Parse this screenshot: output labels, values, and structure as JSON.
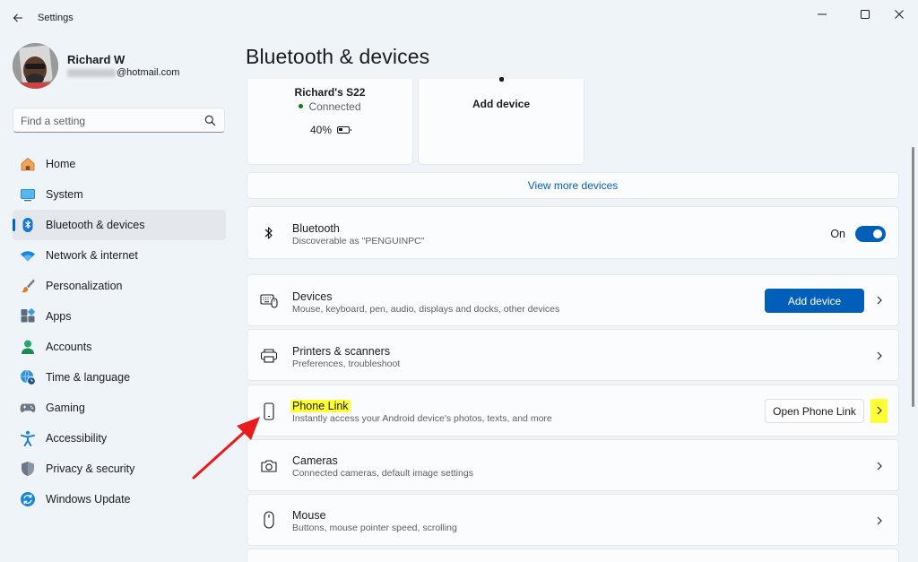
{
  "window": {
    "app_title": "Settings"
  },
  "profile": {
    "name": "Richard W",
    "email_visible": "@hotmail.com"
  },
  "search": {
    "placeholder": "Find a setting"
  },
  "nav": {
    "items": [
      {
        "label": "Home",
        "icon": "home-icon",
        "active": false
      },
      {
        "label": "System",
        "icon": "system-icon",
        "active": false
      },
      {
        "label": "Bluetooth & devices",
        "icon": "bluetooth-icon",
        "active": true
      },
      {
        "label": "Network & internet",
        "icon": "wifi-icon",
        "active": false
      },
      {
        "label": "Personalization",
        "icon": "brush-icon",
        "active": false
      },
      {
        "label": "Apps",
        "icon": "apps-icon",
        "active": false
      },
      {
        "label": "Accounts",
        "icon": "person-icon",
        "active": false
      },
      {
        "label": "Time & language",
        "icon": "globe-clock-icon",
        "active": false
      },
      {
        "label": "Gaming",
        "icon": "gamepad-icon",
        "active": false
      },
      {
        "label": "Accessibility",
        "icon": "accessibility-icon",
        "active": false
      },
      {
        "label": "Privacy & security",
        "icon": "shield-icon",
        "active": false
      },
      {
        "label": "Windows Update",
        "icon": "update-icon",
        "active": false
      }
    ]
  },
  "main": {
    "title": "Bluetooth & devices",
    "device_tiles": [
      {
        "name": "Richard's S22",
        "status": "Connected",
        "battery": "40%"
      },
      {
        "name": "Add device"
      }
    ],
    "view_more": "View more devices",
    "bluetooth": {
      "title": "Bluetooth",
      "subtitle": "Discoverable as \"PENGUINPC\"",
      "state_label": "On"
    },
    "devices": {
      "title": "Devices",
      "subtitle": "Mouse, keyboard, pen, audio, displays and docks, other devices",
      "button": "Add device"
    },
    "printers": {
      "title": "Printers & scanners",
      "subtitle": "Preferences, troubleshoot"
    },
    "phone_link": {
      "title": "Phone Link",
      "subtitle": "Instantly access your Android device's photos, texts, and more",
      "button": "Open Phone Link"
    },
    "cameras": {
      "title": "Cameras",
      "subtitle": "Connected cameras, default image settings"
    },
    "mouse": {
      "title": "Mouse",
      "subtitle": "Buttons, mouse pointer speed, scrolling"
    }
  },
  "colors": {
    "accent": "#005fb8",
    "highlight": "#ffff33",
    "annotation_arrow": "#e81c1c",
    "connected": "#0f7b0f"
  }
}
